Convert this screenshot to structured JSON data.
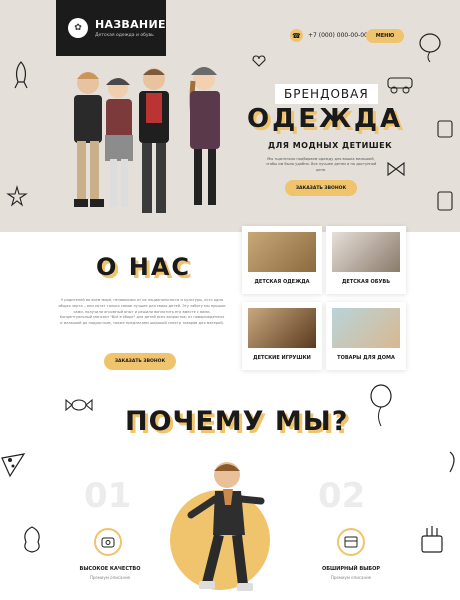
{
  "header": {
    "logo_title": "НАЗВАНИЕ",
    "logo_subtitle": "Детская одежда и обувь",
    "phone": "+7 (000) 000-00-00",
    "menu_label": "МЕНЮ"
  },
  "hero": {
    "brand_label": "БРЕНДОВАЯ",
    "title": "ОДЕЖДА",
    "subtitle": "ДЛЯ МОДНЫХ ДЕТИШЕК",
    "text": "Мы тщательно подбираем одежду для ваших малышей, чтобы им было удобно. Все лучшее детям и по доступной цене.",
    "call_button": "ЗАКАЗАТЬ ЗВОНОК"
  },
  "about": {
    "title": "О НАС",
    "text": "У родителей во всем мире, независимо от их национальности и культуры, есть одна общая черта – они хотят только самое лучшее для своих детей. Эту заботу мы прошли сами, получили огромный опыт и решили воплотить его вместе с вами. Концептуальный магазин \"Всё в сборе\" для детей всех возрастов: от новорожденных и малышей до подростков, также предлагаем широкий спектр товаров для матерей.",
    "call_button": "ЗАКАЗАТЬ ЗВОНОК"
  },
  "categories": [
    {
      "label": "ДЕТСКАЯ ОДЕЖДА",
      "color": "#b89a6a"
    },
    {
      "label": "ДЕТСКАЯ ОБУВЬ",
      "color": "#9a8c80"
    },
    {
      "label": "ДЕТСКИЕ ИГРУШКИ",
      "color": "#7a5a3a"
    },
    {
      "label": "ТОВАРЫ ДЛЯ ДОМА",
      "color": "#a0c0c8"
    }
  ],
  "why": {
    "title": "ПОЧЕМУ МЫ?",
    "num1": "01",
    "num2": "02",
    "feature1_label": "ВЫСОКОЕ КАЧЕСТВО",
    "feature1_sub": "Премиум описание",
    "feature2_label": "ОБШИРНЫЙ ВЫБОР",
    "feature2_sub": "Премиум описание"
  },
  "colors": {
    "accent": "#f0c36d",
    "dark": "#1b1b1b",
    "hero_bg": "#e4dfd8"
  }
}
